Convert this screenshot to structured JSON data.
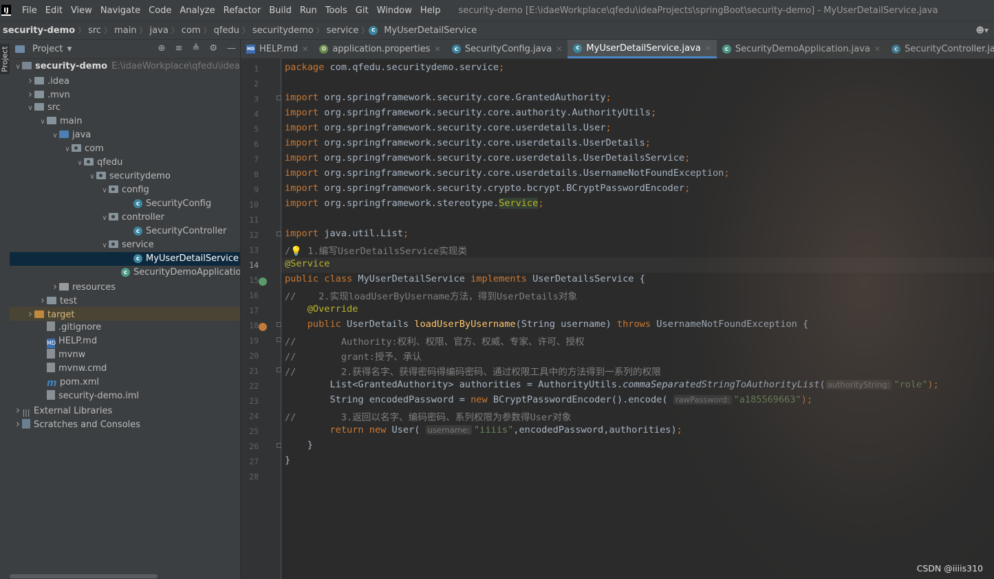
{
  "menubar": {
    "app_icon": "IJ",
    "items": [
      "File",
      "Edit",
      "View",
      "Navigate",
      "Code",
      "Analyze",
      "Refactor",
      "Build",
      "Run",
      "Tools",
      "Git",
      "Window",
      "Help"
    ],
    "window_title": "security-demo [E:\\idaeWorkplace\\qfedu\\ideaProjects\\springBoot\\security-demo] - MyUserDetailService.java"
  },
  "breadcrumb": {
    "items": [
      "security-demo",
      "src",
      "main",
      "java",
      "com",
      "qfedu",
      "securitydemo",
      "service",
      "MyUserDetailService"
    ]
  },
  "side_tab": "Project",
  "project_panel": {
    "title": "Project",
    "tree": [
      {
        "label": "security-demo",
        "path": "E:\\idaeWorkplace\\qfedu\\ideaProj",
        "indent": 0,
        "arrow": "down",
        "icon": "module"
      },
      {
        "label": ".idea",
        "indent": 1,
        "arrow": "right",
        "icon": "folder"
      },
      {
        "label": ".mvn",
        "indent": 1,
        "arrow": "right",
        "icon": "folder"
      },
      {
        "label": "src",
        "indent": 1,
        "arrow": "down",
        "icon": "folder"
      },
      {
        "label": "main",
        "indent": 2,
        "arrow": "down",
        "icon": "folder"
      },
      {
        "label": "java",
        "indent": 3,
        "arrow": "down",
        "icon": "folder-blue"
      },
      {
        "label": "com",
        "indent": 4,
        "arrow": "down",
        "icon": "package"
      },
      {
        "label": "qfedu",
        "indent": 5,
        "arrow": "down",
        "icon": "package"
      },
      {
        "label": "securitydemo",
        "indent": 6,
        "arrow": "down",
        "icon": "package"
      },
      {
        "label": "config",
        "indent": 7,
        "arrow": "down",
        "icon": "package"
      },
      {
        "label": "SecurityConfig",
        "indent": 9,
        "arrow": "",
        "icon": "class"
      },
      {
        "label": "controller",
        "indent": 7,
        "arrow": "down",
        "icon": "package"
      },
      {
        "label": "SecurityController",
        "indent": 9,
        "arrow": "",
        "icon": "class"
      },
      {
        "label": "service",
        "indent": 7,
        "arrow": "down",
        "icon": "package"
      },
      {
        "label": "MyUserDetailService",
        "indent": 9,
        "arrow": "",
        "icon": "class",
        "selected": true
      },
      {
        "label": "SecurityDemoApplication",
        "indent": 8,
        "arrow": "",
        "icon": "app-class"
      },
      {
        "label": "resources",
        "indent": 3,
        "arrow": "right",
        "icon": "folder-res"
      },
      {
        "label": "test",
        "indent": 2,
        "arrow": "right",
        "icon": "folder"
      },
      {
        "label": "target",
        "indent": 1,
        "arrow": "right",
        "icon": "folder-orange",
        "excluded": true
      },
      {
        "label": ".gitignore",
        "indent": 2,
        "arrow": "",
        "icon": "file"
      },
      {
        "label": "HELP.md",
        "indent": 2,
        "arrow": "",
        "icon": "md"
      },
      {
        "label": "mvnw",
        "indent": 2,
        "arrow": "",
        "icon": "file"
      },
      {
        "label": "mvnw.cmd",
        "indent": 2,
        "arrow": "",
        "icon": "file"
      },
      {
        "label": "pom.xml",
        "indent": 2,
        "arrow": "",
        "icon": "maven"
      },
      {
        "label": "security-demo.iml",
        "indent": 2,
        "arrow": "",
        "icon": "file"
      },
      {
        "label": "External Libraries",
        "indent": 0,
        "arrow": "right",
        "icon": "libs"
      },
      {
        "label": "Scratches and Consoles",
        "indent": 0,
        "arrow": "right",
        "icon": "scratch"
      }
    ]
  },
  "tabs": [
    {
      "label": "HELP.md",
      "icon": "md"
    },
    {
      "label": "application.properties",
      "icon": "prop"
    },
    {
      "label": "SecurityConfig.java",
      "icon": "class"
    },
    {
      "label": "MyUserDetailService.java",
      "icon": "class",
      "active": true
    },
    {
      "label": "SecurityDemoApplication.java",
      "icon": "app"
    },
    {
      "label": "SecurityController.java",
      "icon": "class"
    }
  ],
  "current_line": 14,
  "code_lines": [
    [
      [
        "kw",
        "package "
      ],
      [
        "",
        "com.qfedu.securitydemo.service"
      ],
      [
        "kw",
        ";"
      ]
    ],
    [],
    [
      [
        "kw",
        "import "
      ],
      [
        "",
        "org.springframework.security.core.GrantedAuthority"
      ],
      [
        "kw",
        ";"
      ]
    ],
    [
      [
        "kw",
        "import "
      ],
      [
        "",
        "org.springframework.security.core.authority.AuthorityUtils"
      ],
      [
        "kw",
        ";"
      ]
    ],
    [
      [
        "kw",
        "import "
      ],
      [
        "",
        "org.springframework.security.core.userdetails.User"
      ],
      [
        "kw",
        ";"
      ]
    ],
    [
      [
        "kw",
        "import "
      ],
      [
        "",
        "org.springframework.security.core.userdetails.UserDetails"
      ],
      [
        "kw",
        ";"
      ]
    ],
    [
      [
        "kw",
        "import "
      ],
      [
        "",
        "org.springframework.security.core.userdetails.UserDetailsService"
      ],
      [
        "kw",
        ";"
      ]
    ],
    [
      [
        "kw",
        "import "
      ],
      [
        "",
        "org.springframework.security.core.userdetails.UsernameNotFoundException"
      ],
      [
        "kw",
        ";"
      ]
    ],
    [
      [
        "kw",
        "import "
      ],
      [
        "",
        "org.springframework.security.crypto.bcrypt.BCryptPasswordEncoder"
      ],
      [
        "kw",
        ";"
      ]
    ],
    [
      [
        "kw",
        "import "
      ],
      [
        "",
        "org.springframework.stereotype."
      ],
      [
        "svc",
        "Service"
      ],
      [
        "kw",
        ";"
      ]
    ],
    [],
    [
      [
        "kw",
        "import "
      ],
      [
        "",
        "java.util.List"
      ],
      [
        "kw",
        ";"
      ]
    ],
    [
      [
        "cmt",
        "/"
      ],
      [
        "fn",
        "💡"
      ],
      [
        "cmt",
        " 1.编写UserDetailsService实现类"
      ]
    ],
    [
      [
        "ann",
        "@Service"
      ]
    ],
    [
      [
        "kw",
        "public class "
      ],
      [
        "",
        "MyUserDetailService "
      ],
      [
        "kw",
        "implements "
      ],
      [
        "",
        "UserDetailsService {"
      ]
    ],
    [
      [
        "cmt",
        "//    2.实现loadUserByUsername方法，得到UserDetails对象"
      ]
    ],
    [
      [
        "",
        "    "
      ],
      [
        "ann",
        "@Override"
      ]
    ],
    [
      [
        "",
        "    "
      ],
      [
        "kw",
        "public "
      ],
      [
        "",
        "UserDetails "
      ],
      [
        "fn",
        "loadUserByUsername"
      ],
      [
        "",
        "(String username) "
      ],
      [
        "kw",
        "throws "
      ],
      [
        "",
        "UsernameNotFoundException {"
      ]
    ],
    [
      [
        "cmt",
        "//        Authority:权利、权限、官方、权威、专家、许可、授权"
      ]
    ],
    [
      [
        "cmt",
        "//        grant:授予、承认"
      ]
    ],
    [
      [
        "cmt",
        "//        2.获得名字、获得密码得编码密码、通过权限工具中的方法得到一系列的权限"
      ]
    ],
    [
      [
        "",
        "        List<GrantedAuthority> authorities = AuthorityUtils."
      ],
      [
        "it",
        "commaSeparatedStringToAuthorityList"
      ],
      [
        "",
        "("
      ],
      [
        "hint",
        "authorityString:"
      ],
      [
        "str",
        "\"role\""
      ],
      [
        "kw",
        ");"
      ]
    ],
    [
      [
        "",
        "        String encodedPassword = "
      ],
      [
        "kw",
        "new "
      ],
      [
        "",
        "BCryptPasswordEncoder().encode( "
      ],
      [
        "hint",
        "rawPassword:"
      ],
      [
        "str",
        "\"a185569663\""
      ],
      [
        "kw",
        ");"
      ]
    ],
    [
      [
        "cmt",
        "//        3.返回以名字、编码密码、系列权限为参数得User对象"
      ]
    ],
    [
      [
        "",
        "        "
      ],
      [
        "kw",
        "return new "
      ],
      [
        "",
        "User( "
      ],
      [
        "hint",
        "username:"
      ],
      [
        "str",
        "\"iiiis\""
      ],
      [
        "",
        ",encodedPassword,authorities)"
      ],
      [
        "kw",
        ";"
      ]
    ],
    [
      [
        "",
        "    }"
      ]
    ],
    [
      [
        "",
        "}"
      ]
    ],
    []
  ],
  "watermark": "CSDN @iiiis310",
  "colors": {
    "accent": "#4a88c7",
    "selection": "#0d293e",
    "keyword": "#cc7832",
    "annotation": "#bbb529",
    "string": "#6a8759",
    "comment": "#808080"
  }
}
